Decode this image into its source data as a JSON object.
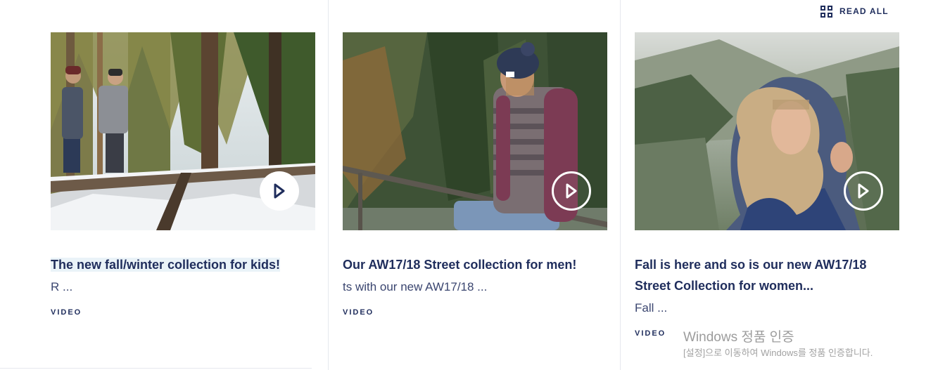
{
  "header": {
    "read_all_label": "READ ALL",
    "read_all_icon": "grid-icon"
  },
  "cards": [
    {
      "title": "The new fall/winter collection for kids!",
      "excerpt": "R ...",
      "tag": "VIDEO",
      "play_icon": "play-icon"
    },
    {
      "title": "Our AW17/18 Street collection for men!",
      "excerpt": "ts with our new AW17/18 ...",
      "tag": "VIDEO",
      "play_icon": "play-icon"
    },
    {
      "title": "Fall is here and so is our new AW17/18 Street Collection for women...",
      "excerpt": "Fall ...",
      "tag": "VIDEO",
      "play_icon": "play-icon"
    }
  ],
  "watermark": {
    "title": "Windows 정품 인증",
    "subtitle": "[설정]으로 이동하여 Windows를 정품 인증합니다."
  },
  "colors": {
    "brand_navy": "#1f2d5c",
    "divider": "#e6e8ee",
    "highlight": "#eaf3f8"
  }
}
